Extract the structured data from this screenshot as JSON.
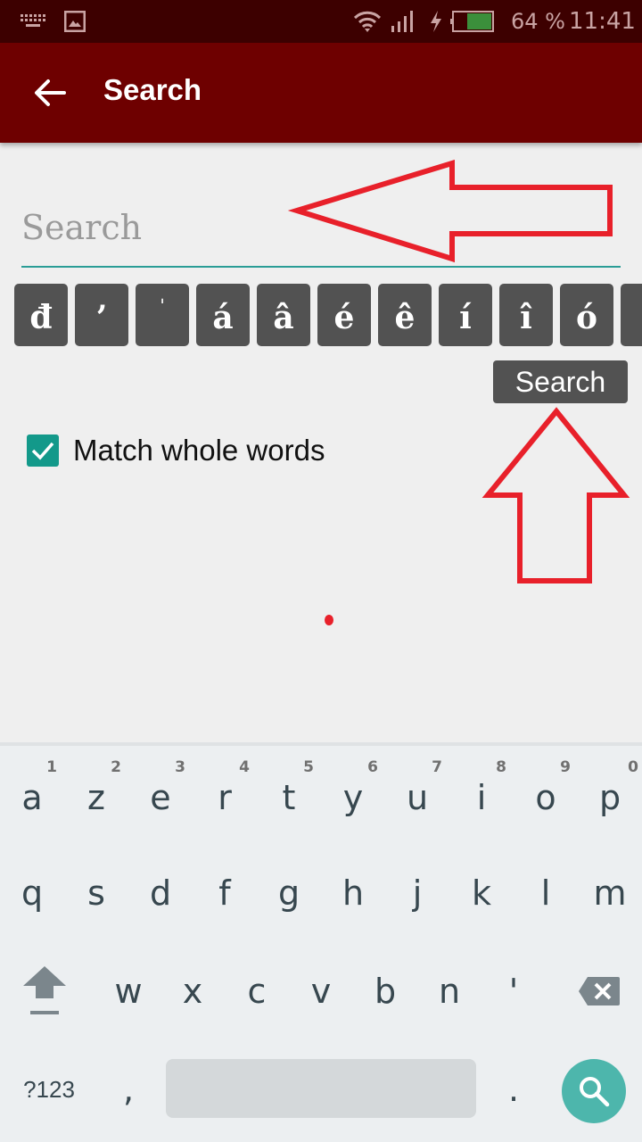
{
  "status_bar": {
    "left_icons": [
      "keyboard-icon",
      "image-icon"
    ],
    "right_icons": [
      "wifi-icon",
      "signal-icon",
      "charging-icon",
      "battery-icon"
    ],
    "battery_percent": "64 %",
    "time": "11:41",
    "battery_level": 0.64,
    "colors": {
      "background": "#3d0000",
      "battery_fill": "#3b8f3b"
    }
  },
  "app_bar": {
    "title": "Search",
    "back_icon": "arrow-left-icon",
    "colors": {
      "background": "#6e0000",
      "text": "#ffffff"
    }
  },
  "search": {
    "placeholder": "Search",
    "value": "",
    "underline_color": "#2a9d96"
  },
  "special_chars": [
    "đ",
    "’",
    "ˈ",
    "á",
    "â",
    "é",
    "ê",
    "í",
    "î",
    "ó",
    ""
  ],
  "search_button": {
    "label": "Search"
  },
  "options": {
    "match_whole_words": {
      "label": "Match whole words",
      "checked": true,
      "color": "#13998a"
    }
  },
  "annotations": {
    "color": "#e8202a",
    "items": [
      "arrow-pointing-to-search-field",
      "arrow-pointing-to-search-button"
    ]
  },
  "keyboard": {
    "row1": [
      {
        "key": "a",
        "hint": "1"
      },
      {
        "key": "z",
        "hint": "2"
      },
      {
        "key": "e",
        "hint": "3"
      },
      {
        "key": "r",
        "hint": "4"
      },
      {
        "key": "t",
        "hint": "5"
      },
      {
        "key": "y",
        "hint": "6"
      },
      {
        "key": "u",
        "hint": "7"
      },
      {
        "key": "i",
        "hint": "8"
      },
      {
        "key": "o",
        "hint": "9"
      },
      {
        "key": "p",
        "hint": "0"
      }
    ],
    "row2": [
      "q",
      "s",
      "d",
      "f",
      "g",
      "h",
      "j",
      "k",
      "l",
      "m"
    ],
    "row3": [
      "w",
      "x",
      "c",
      "v",
      "b",
      "n",
      "'"
    ],
    "symbols_label": "?123",
    "comma": ",",
    "period": ".",
    "action_icon": "search-icon",
    "colors": {
      "background": "#eceff1",
      "key_text": "#37474f",
      "action": "#4db6ac",
      "spacebar": "#d4d8da"
    }
  }
}
